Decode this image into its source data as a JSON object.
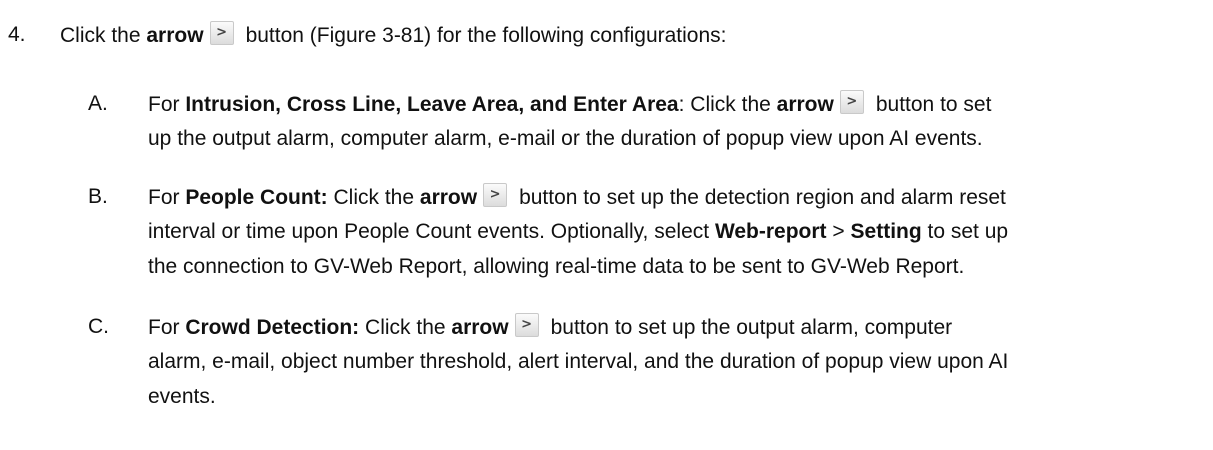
{
  "step": {
    "number": "4.",
    "click_the": "Click the",
    "arrow": "arrow",
    "rest": "button (Figure 3-81) for the following configurations:"
  },
  "arrow_glyph": ">",
  "items": {
    "a": {
      "marker": "A.",
      "l1_pre": "For",
      "l1_bold": "Intrusion, Cross Line, Leave Area, and Enter Area",
      "l1_mid": ": Click the",
      "l1_arrow": "arrow",
      "l1_post": "button to set",
      "l2": "up the output alarm, computer alarm, e-mail or the duration of popup view upon AI events."
    },
    "b": {
      "marker": "B.",
      "l1_pre": "For",
      "l1_bold": "People Count:",
      "l1_mid": "Click the",
      "l1_arrow": "arrow",
      "l1_post": "button to set up the detection region and alarm reset",
      "l2_pre": "interval or time upon People Count events. Optionally, select",
      "l2_bold1": "Web-report",
      "l2_sep": ">",
      "l2_bold2": "Setting",
      "l2_post": "to set up",
      "l3": "the connection to GV-Web Report, allowing real-time data to be sent to GV-Web Report."
    },
    "c": {
      "marker": "C.",
      "l1_pre": "For",
      "l1_bold": "Crowd Detection:",
      "l1_mid": "Click the",
      "l1_arrow": "arrow",
      "l1_post": "button to set up the output alarm, computer",
      "l2": "alarm, e-mail, object number threshold, alert interval, and the duration of popup view upon AI",
      "l3": "events."
    }
  }
}
